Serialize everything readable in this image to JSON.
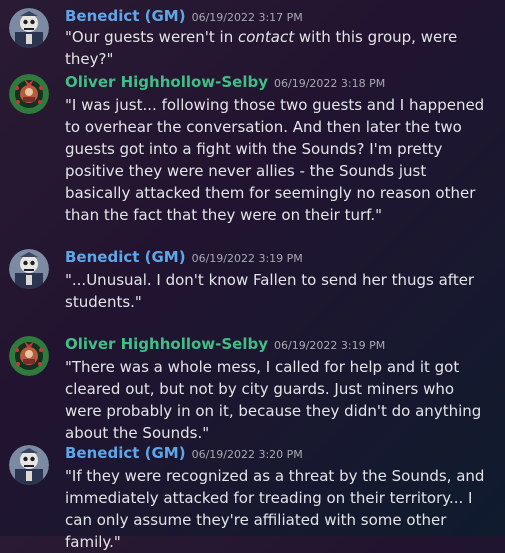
{
  "messages": [
    {
      "author": "Benedict (GM)",
      "timestamp": "06/19/2022 3:17 PM",
      "text_before": "\"Our guests weren't in ",
      "text_emphasis": "contact",
      "text_after": " with this group, were they?\""
    },
    {
      "author": "Oliver Highhollow-Selby",
      "timestamp": "06/19/2022 3:18 PM",
      "text": "\"I was just... following those two guests and I happened to overhear the conversation. And then later the two guests got into a fight with the Sounds? I'm pretty positive they were never allies - the Sounds just basically attacked them for seemingly no reason other than the fact that they were on their turf.\""
    },
    {
      "author": "Benedict (GM)",
      "timestamp": "06/19/2022 3:19 PM",
      "text": "\"...Unusual. I don't know Fallen to send her thugs after students.\""
    },
    {
      "author": "Oliver Highhollow-Selby",
      "timestamp": "06/19/2022 3:19 PM",
      "text": "\"There was a whole mess, I called for help and it got cleared out, but not by city guards. Just miners who were probably in on it, because they didn't do anything about the Sounds.\""
    },
    {
      "author": "Benedict (GM)",
      "timestamp": "06/19/2022 3:20 PM",
      "text": "\"If they were recognized as a threat by the Sounds, and immediately attacked for treading on their territory... I can only assume they're affiliated with some other family.\""
    }
  ],
  "colors": {
    "gm_name": "#5fa6e8",
    "oliver_name": "#3fbf86",
    "timestamp": "#a7a9b1",
    "text": "#e3e4e8"
  },
  "avatars": {
    "gm": "skeleton-gm-avatar-icon",
    "oliver": "wreath-portrait-avatar-icon"
  }
}
